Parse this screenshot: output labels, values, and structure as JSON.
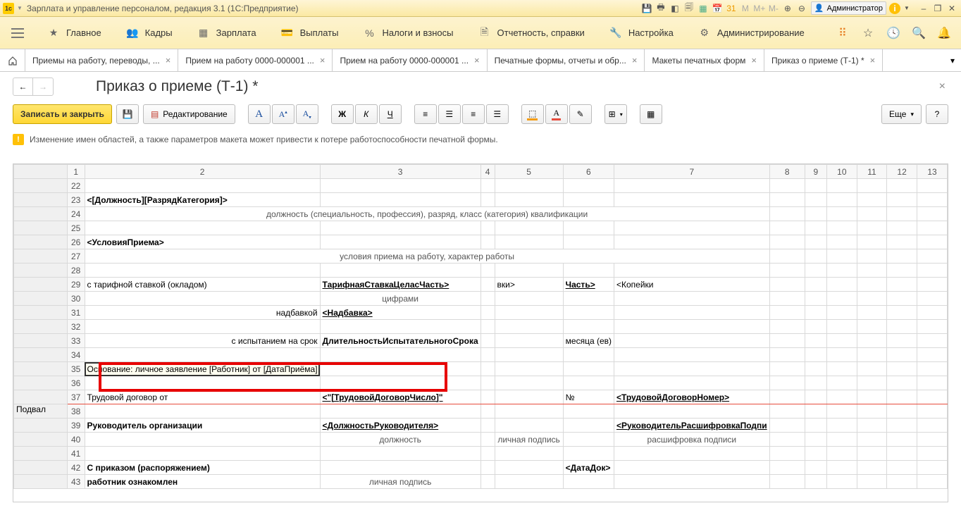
{
  "titlebar": {
    "title": "Зарплата и управление персоналом, редакция 3.1  (1С:Предприятие)",
    "user": "Администратор"
  },
  "mainnav": {
    "items": [
      {
        "icon": "star",
        "label": "Главное"
      },
      {
        "icon": "people",
        "label": "Кадры"
      },
      {
        "icon": "grid",
        "label": "Зарплата"
      },
      {
        "icon": "wallet",
        "label": "Выплаты"
      },
      {
        "icon": "percent",
        "label": "Налоги и взносы"
      },
      {
        "icon": "report",
        "label": "Отчетность, справки"
      },
      {
        "icon": "wrench",
        "label": "Настройка"
      },
      {
        "icon": "gear",
        "label": "Администрирование"
      }
    ]
  },
  "tabs": {
    "items": [
      "Приемы на работу, переводы, ...",
      "Прием на работу 0000-000001 ...",
      "Прием на работу 0000-000001 ...",
      "Печатные формы, отчеты и обр...",
      "Макеты печатных форм",
      "Приказ о приеме (Т-1) *"
    ],
    "active": 5
  },
  "page": {
    "title": "Приказ о приеме (Т-1) *"
  },
  "toolbar": {
    "save_close": "Записать и закрыть",
    "edit": "Редактирование",
    "more": "Еще"
  },
  "warning": "Изменение имен областей, а также параметров макета может привести к потере работоспособности печатной формы.",
  "columns": [
    "",
    "1",
    "2",
    "3",
    "4",
    "5",
    "6",
    "7",
    "8",
    "9",
    "10",
    "11",
    "12",
    "13"
  ],
  "rows": [
    {
      "n": "22",
      "cells": {}
    },
    {
      "n": "23",
      "cells": {
        "c2": "<[Должность][РазрядКатегория]>",
        "cls": "bold"
      }
    },
    {
      "n": "24",
      "cells": {
        "c2": "должность (специальность, профессия), разряд, класс (категория) квалификации",
        "cls": "small center",
        "span": "wide"
      }
    },
    {
      "n": "25",
      "cells": {}
    },
    {
      "n": "26",
      "cells": {
        "c2": "<УсловияПриема>",
        "cls": "bold"
      }
    },
    {
      "n": "27",
      "cells": {
        "c2": "условия приема на работу, характер работы",
        "cls": "small center",
        "span": "wide"
      }
    },
    {
      "n": "28",
      "cells": {}
    },
    {
      "n": "29",
      "cells": {
        "c2": "с тарифной ставкой (окладом)",
        "c3": "ТарифнаяСтавкаЦеласЧасть>",
        "c3cls": "bold uline",
        "c5": "вки>",
        "c6": "Часть>",
        "c6cls": "bold uline",
        "c7": "<Копейки"
      }
    },
    {
      "n": "30",
      "cells": {
        "c3": "цифрами",
        "cls": "small center"
      }
    },
    {
      "n": "31",
      "cells": {
        "c2": "надбавкой",
        "c2cls": "right",
        "c3": "<Надбавка>",
        "c3cls": "bold uline"
      }
    },
    {
      "n": "32",
      "cells": {}
    },
    {
      "n": "33",
      "cells": {
        "c2": "с испытанием на срок",
        "c3": "ДлительностьИспытательногоСрока",
        "c3cls": "bold",
        "c6": "месяца (ев)"
      }
    },
    {
      "n": "34",
      "cells": {}
    },
    {
      "n": "35",
      "cells": {
        "c2": "Основание: личное заявление [Работник] от [ДатаПриёма]",
        "highlight": true
      }
    },
    {
      "n": "36",
      "cells": {}
    },
    {
      "n": "37",
      "cells": {
        "c2": "Трудовой договор от",
        "c3": "<\"[ТрудовойДоговорЧисло]\"",
        "c3cls": "bold uline",
        "c6": "№",
        "c7": "<ТрудовойДоговорНомер>",
        "c7cls": "bold uline"
      }
    },
    {
      "n": "38",
      "cells": {
        "section": "Подвал"
      }
    },
    {
      "n": "39",
      "cells": {
        "c2": "Руководитель организации",
        "cls": "bold",
        "c3": "<ДолжностьРуководителя>",
        "c3cls": "bold uline",
        "c7": "<РуководительРасшифровкаПодпи",
        "c7cls": "bold uline"
      }
    },
    {
      "n": "40",
      "cells": {
        "c3": "должность",
        "c5": "личная подпись",
        "c7": "расшифровка  подписи",
        "cls": "small center"
      }
    },
    {
      "n": "41",
      "cells": {}
    },
    {
      "n": "42",
      "cells": {
        "c2": "С приказом (распоряжением)",
        "cls": "bold",
        "c6": "<ДатаДок>",
        "c6cls": "bold"
      }
    },
    {
      "n": "43",
      "cells": {
        "c2": "работник ознакомлен",
        "cls": "bold",
        "c3": "личная подпись",
        "c3cls": "small center"
      }
    }
  ]
}
